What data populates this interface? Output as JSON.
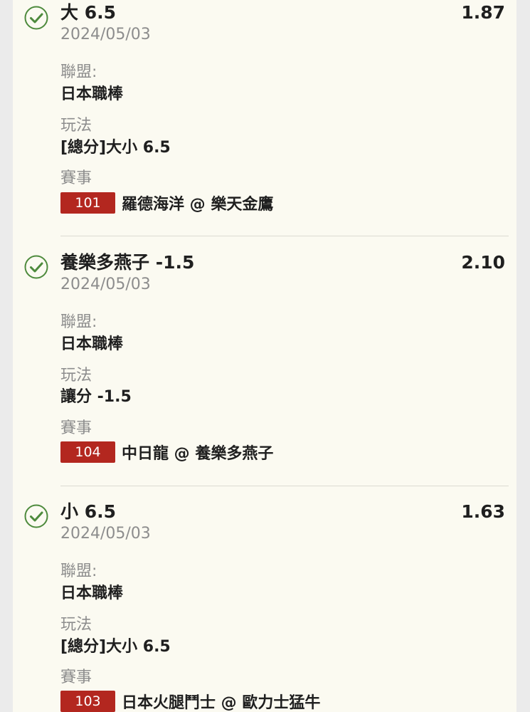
{
  "colors": {
    "page_bg": "#ebebeb",
    "card_bg": "#fbfaf1",
    "check_green": "#4d8a3c",
    "badge_red": "#b3271f",
    "muted_text": "#8d8d8d"
  },
  "labels": {
    "league": "聯盟:",
    "play_type": "玩法",
    "event": "賽事"
  },
  "bets": [
    {
      "selection": "大 6.5",
      "odds": "1.87",
      "date": "2024/05/03",
      "league": "日本職棒",
      "play_type": "[總分]大小 6.5",
      "game_number": "101",
      "matchup": "羅德海洋 @ 樂天金鷹",
      "status_icon": "check-circle-icon"
    },
    {
      "selection": "養樂多燕子 -1.5",
      "odds": "2.10",
      "date": "2024/05/03",
      "league": "日本職棒",
      "play_type": "讓分 -1.5",
      "game_number": "104",
      "matchup": "中日龍 @ 養樂多燕子",
      "status_icon": "check-circle-icon"
    },
    {
      "selection": "小 6.5",
      "odds": "1.63",
      "date": "2024/05/03",
      "league": "日本職棒",
      "play_type": "[總分]大小 6.5",
      "game_number": "103",
      "matchup": "日本火腿鬥士 @ 歐力士猛牛",
      "status_icon": "check-circle-icon"
    }
  ]
}
